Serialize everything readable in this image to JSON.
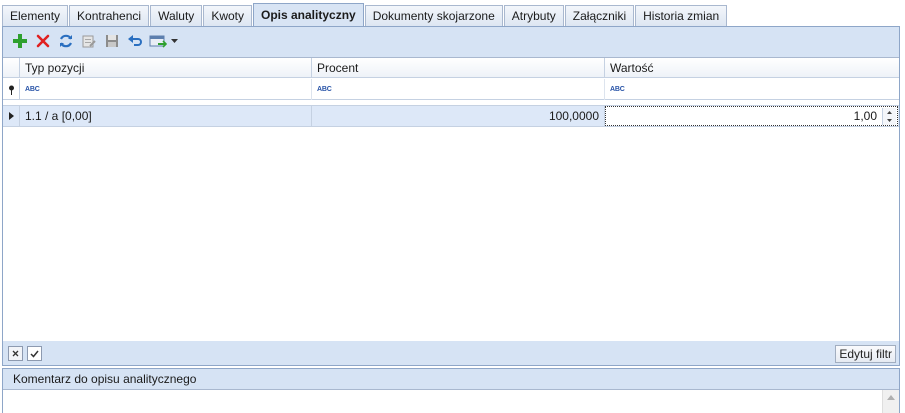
{
  "tabs": [
    {
      "label": "Elementy"
    },
    {
      "label": "Kontrahenci"
    },
    {
      "label": "Waluty"
    },
    {
      "label": "Kwoty"
    },
    {
      "label": "Opis analityczny"
    },
    {
      "label": "Dokumenty skojarzone"
    },
    {
      "label": "Atrybuty"
    },
    {
      "label": "Załączniki"
    },
    {
      "label": "Historia zmian"
    }
  ],
  "active_tab": "Opis analityczny",
  "toolbar": {
    "icons": [
      "add-icon",
      "delete-icon",
      "refresh-icon",
      "edit-icon",
      "save-icon",
      "undo-icon",
      "export-icon"
    ]
  },
  "grid": {
    "columns": [
      {
        "header": "Typ pozycji"
      },
      {
        "header": "Procent"
      },
      {
        "header": "Wartość"
      }
    ],
    "filter_glyph": "ABC",
    "rows": [
      {
        "typ": "1.1 / a [0,00]",
        "procent": "100,0000",
        "wartosc": "1,00"
      }
    ]
  },
  "bottombar": {
    "edit_filter_label": "Edytuj filtr"
  },
  "comment": {
    "label": "Komentarz do opisu analitycznego",
    "value": ""
  },
  "colors": {
    "panel_bg": "#d6e3f4",
    "row_selected": "#dde8f8",
    "add_green": "#2ea02e",
    "delete_red": "#e02020",
    "accent_blue": "#2a6fc0"
  }
}
